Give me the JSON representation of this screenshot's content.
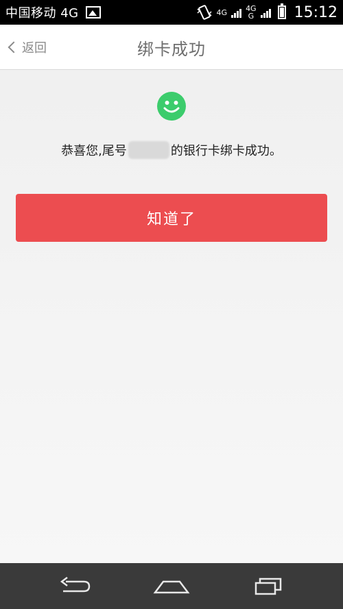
{
  "status_bar": {
    "carrier": "中国移动 4G",
    "net_type": "4G",
    "net_type2_top": "4G",
    "net_type2_bottom": "G",
    "time": "15:12"
  },
  "header": {
    "back_label": "返回",
    "title": "绑卡成功"
  },
  "main": {
    "message_prefix": "恭喜您,尾号",
    "message_suffix": "的银行卡绑卡成功。",
    "confirm_label": "知道了"
  },
  "icons": {
    "back": "chevron-left-icon",
    "success": "smiley-icon",
    "nav_back": "back-arrow-icon",
    "nav_home": "home-icon",
    "nav_recent": "recent-apps-icon"
  },
  "colors": {
    "accent": "#ec4d50",
    "success": "#3ccc6c",
    "title": "#6e6e6e",
    "nav_bg": "#3a3a3a"
  }
}
